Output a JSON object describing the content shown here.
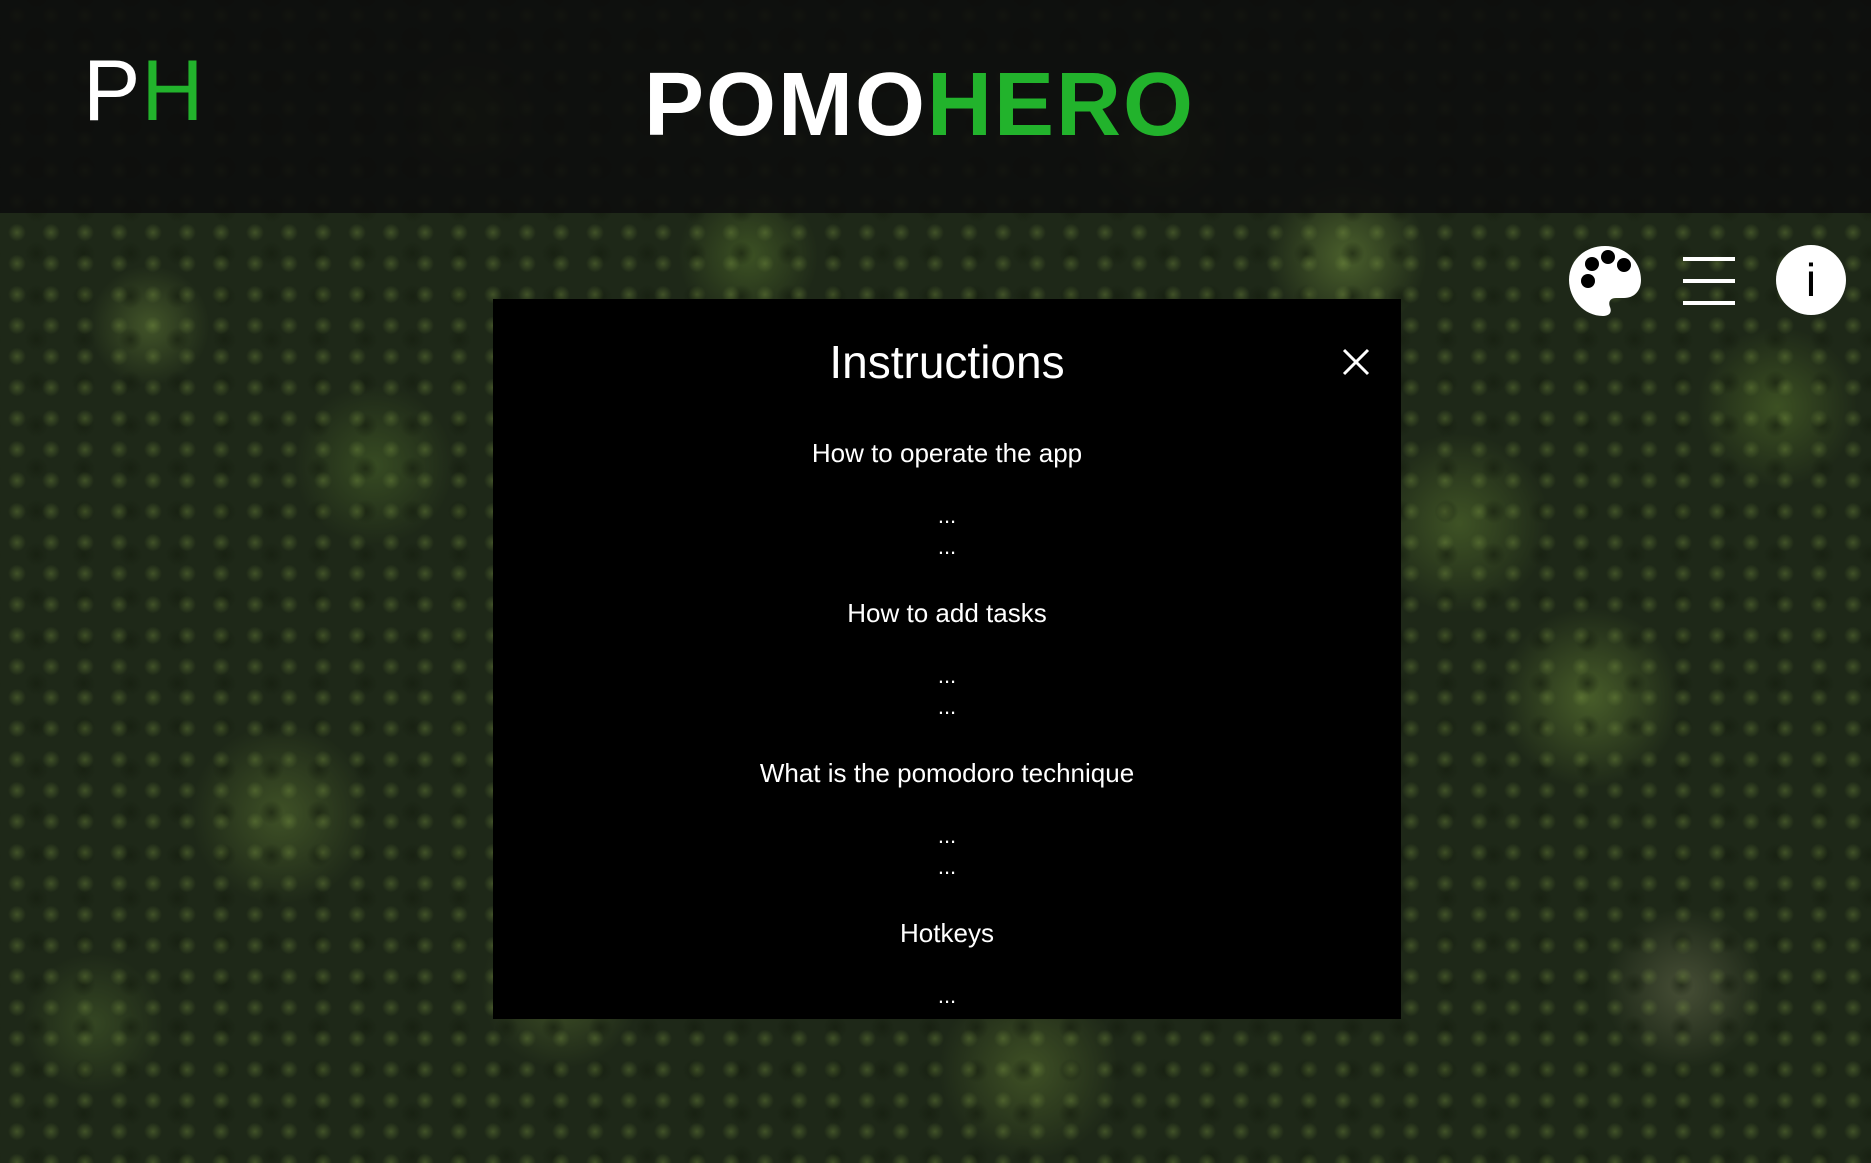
{
  "app": {
    "logo_small": {
      "first": "P",
      "second": "H"
    },
    "logo_big": {
      "first": "POMO",
      "second": "HERO"
    },
    "colors": {
      "accent_green": "#22b32c",
      "header_bg": "#0c0c0c",
      "modal_bg": "#000000",
      "text": "#ffffff"
    }
  },
  "toolbar": {
    "icons": [
      "palette-icon",
      "menu-icon",
      "info-icon"
    ],
    "info_glyph": "i"
  },
  "modal": {
    "title": "Instructions",
    "close_icon": "close-icon",
    "sections": [
      {
        "heading": "How to operate the app",
        "lines": [
          "...",
          "..."
        ]
      },
      {
        "heading": "How to add tasks",
        "lines": [
          "...",
          "..."
        ]
      },
      {
        "heading": "What is the pomodoro technique",
        "lines": [
          "...",
          "..."
        ]
      },
      {
        "heading": "Hotkeys",
        "lines": [
          "..."
        ]
      }
    ]
  }
}
